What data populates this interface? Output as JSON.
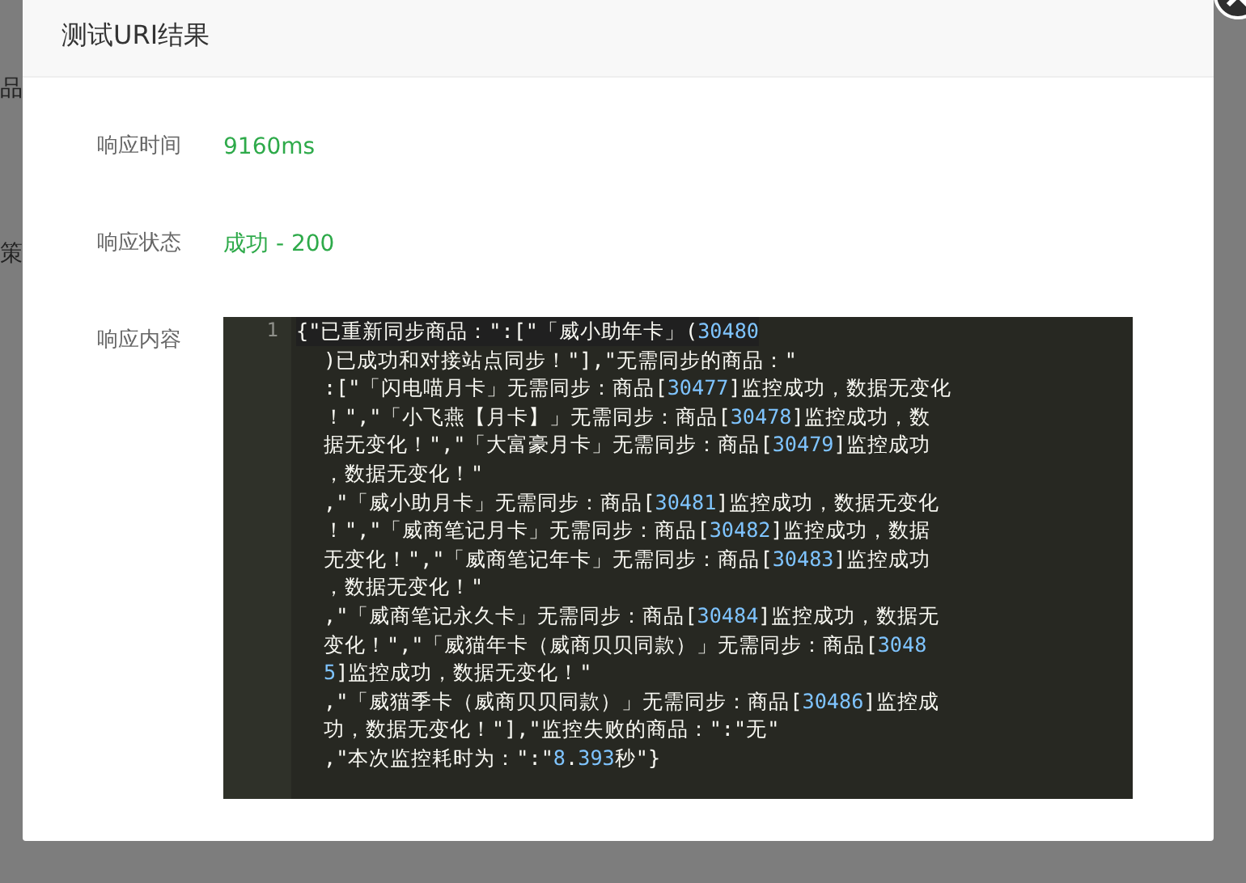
{
  "background_fragments": [
    "品",
    "策"
  ],
  "dialog": {
    "title": "测试URI结果",
    "fields": [
      {
        "label": "响应时间",
        "value": "9160ms"
      },
      {
        "label": "响应状态",
        "value": "成功 - 200"
      }
    ],
    "content_label": "响应内容",
    "code": {
      "line_number": "1",
      "rows": [
        "{\"已重新同步商品：\":[\"「威小助年卡」(30480",
        ")已成功和对接站点同步！\"],\"无需同步的商品：\"",
        ":[\"「闪电喵月卡」无需同步：商品[30477]监控成功，数据无变化",
        "！\",\"「小飞燕【月卡】」无需同步：商品[30478]监控成功，数",
        "据无变化！\",\"「大富豪月卡」无需同步：商品[30479]监控成功",
        "，数据无变化！\"",
        ",\"「威小助月卡」无需同步：商品[30481]监控成功，数据无变化",
        "！\",\"「威商笔记月卡」无需同步：商品[30482]监控成功，数据",
        "无变化！\",\"「威商笔记年卡」无需同步：商品[30483]监控成功",
        "，数据无变化！\"",
        ",\"「威商笔记永久卡」无需同步：商品[30484]监控成功，数据无",
        "变化！\",\"「威猫年卡（威商贝贝同款）」无需同步：商品[3048",
        "5]监控成功，数据无变化！\"",
        ",\"「威猫季卡（威商贝贝同款）」无需同步：商品[30486]监控成",
        "功，数据无变化！\"],\"监控失败的商品：\":\"无\"",
        ",\"本次监控耗时为：\":\"8.393秒\"}"
      ]
    }
  }
}
